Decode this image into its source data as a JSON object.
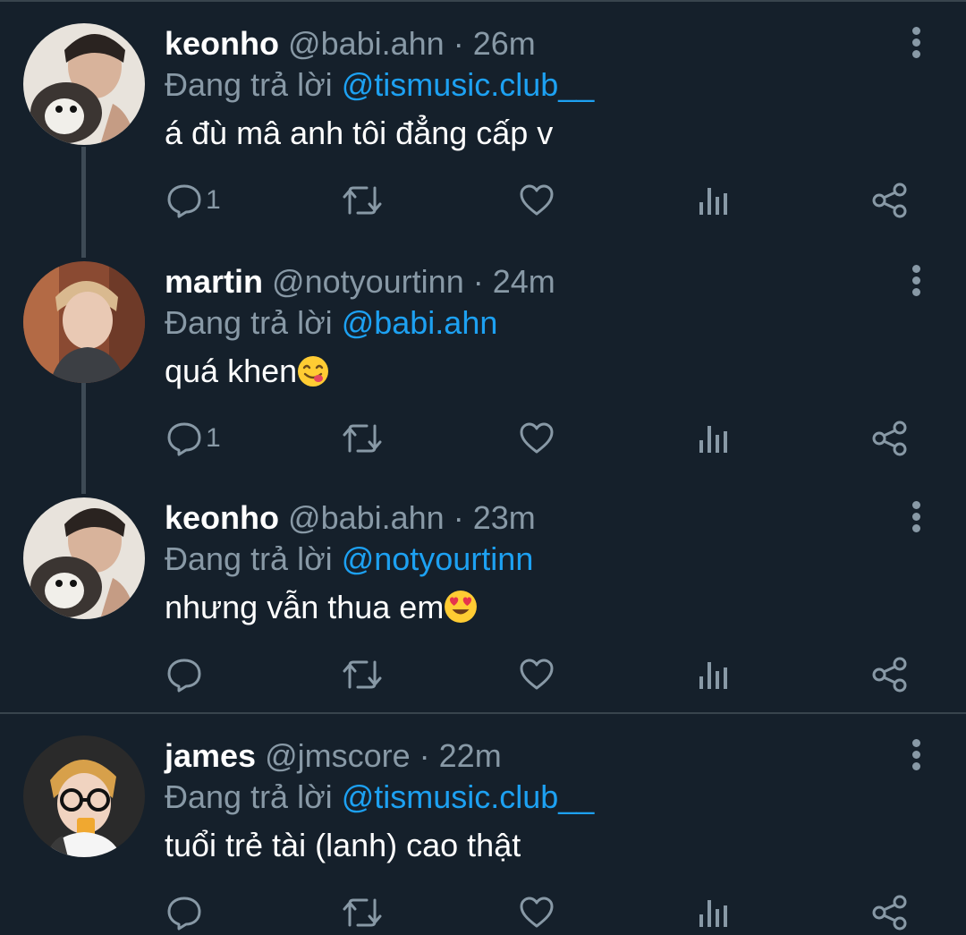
{
  "tweets": [
    {
      "name": "keonho",
      "handle": "@babi.ahn",
      "sep": " · ",
      "time": "26m",
      "reply_prefix": "Đang trả lời ",
      "reply_to": "@tismusic.club__",
      "text": "á đù mâ anh tôi đẳng cấp v",
      "reply_count": "1"
    },
    {
      "name": "martin",
      "handle": "@notyourtinn",
      "sep": " · ",
      "time": "24m",
      "reply_prefix": "Đang trả lời ",
      "reply_to": "@babi.ahn",
      "text": "quá khen",
      "reply_count": "1"
    },
    {
      "name": "keonho",
      "handle": "@babi.ahn",
      "sep": " · ",
      "time": "23m",
      "reply_prefix": "Đang trả lời ",
      "reply_to": "@notyourtinn",
      "text": "nhưng vẫn thua em",
      "reply_count": ""
    },
    {
      "name": "james",
      "handle": "@jmscore",
      "sep": " · ",
      "time": "22m",
      "reply_prefix": "Đang trả lời ",
      "reply_to": "@tismusic.club__",
      "text": "tuổi trẻ tài (lanh) cao thật",
      "reply_count": ""
    }
  ],
  "colors": {
    "background": "#15202b",
    "secondary_text": "#8899a6",
    "link": "#1da1f2",
    "divider": "#38444d"
  },
  "icons": [
    "reply-icon",
    "retweet-icon",
    "like-icon",
    "analytics-icon",
    "share-icon",
    "more-icon",
    "yum-emoji",
    "heart-eyes-emoji"
  ]
}
